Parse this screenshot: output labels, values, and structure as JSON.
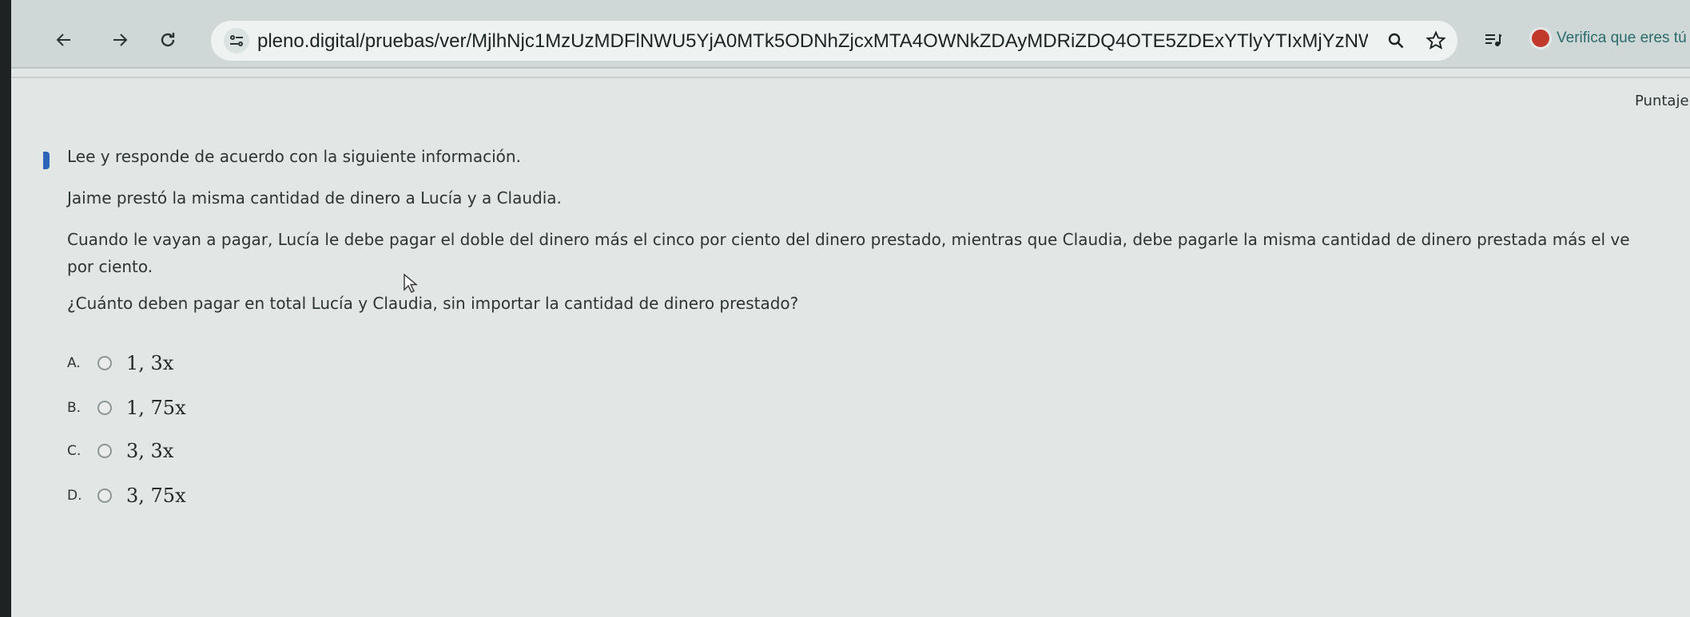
{
  "browser": {
    "url": "pleno.digital/pruebas/ver/MjlhNjc1MzUzMDFlNWU5YjA0MTk5ODNhZjcxMTA4OWNkZDAyMDRiZDQ4OTE5ZDExYTlyYTIxMjYzNWI1MWIyZGVi...",
    "verify_label": "Verifica que eres tú",
    "icons": [
      "back-arrow-icon",
      "forward-arrow-icon",
      "reload-icon",
      "site-info-icon",
      "zoom-icon",
      "star-icon",
      "media-controls-icon"
    ]
  },
  "page": {
    "score_label": "Puntaje",
    "instruction": "Lee y responde de acuerdo con la siguiente información.",
    "context_1": "Jaime prestó la misma cantidad de dinero a Lucía y a Claudia.",
    "context_2_line1": "Cuando le vayan a pagar, Lucía le debe pagar el doble del dinero más el cinco por ciento del dinero prestado, mientras que Claudia, debe pagarle la misma cantidad de dinero prestada más el ve",
    "context_2_line2": "por ciento.",
    "question": "¿Cuánto deben pagar en total Lucía y Claudia, sin importar la cantidad de dinero prestado?",
    "options": [
      {
        "letter": "A.",
        "text": "1, 3x"
      },
      {
        "letter": "B.",
        "text": "1, 75x"
      },
      {
        "letter": "C.",
        "text": "3, 3x"
      },
      {
        "letter": "D.",
        "text": "3, 75x"
      }
    ]
  },
  "colors": {
    "accent": "#2c65b8",
    "verify_dot": "#c0392b",
    "verify_text": "#2b6b6b"
  }
}
